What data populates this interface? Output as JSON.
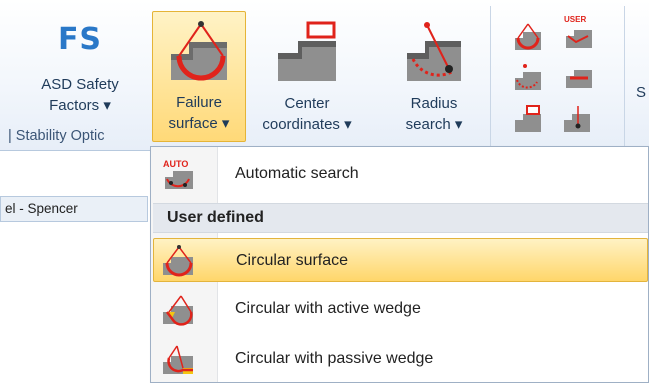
{
  "ribbon": {
    "fs_logo_text": "FS",
    "buttons": {
      "safety": {
        "line1": "ASD Safety",
        "line2": "Factors ▾"
      },
      "failure": {
        "line1": "Failure",
        "line2": "surface ▾"
      },
      "center": {
        "line1": "Center",
        "line2": "coordinates ▾"
      },
      "radius": {
        "line1": "Radius",
        "line2": "search ▾"
      }
    },
    "group_label": "| Stability Optic",
    "cut_label": "S",
    "user_badge": "USER"
  },
  "tab": {
    "label": "el - Spencer"
  },
  "dropdown": {
    "auto_badge": "AUTO",
    "items": [
      {
        "label": "Automatic search",
        "icon": "auto-search-icon"
      },
      {
        "label": "Circular surface",
        "icon": "circular-surface-icon"
      },
      {
        "label": "Circular with active wedge",
        "icon": "active-wedge-icon"
      },
      {
        "label": "Circular with passive wedge",
        "icon": "passive-wedge-icon"
      }
    ],
    "header": "User defined"
  },
  "colors": {
    "accent": "#2a78c8",
    "highlight": "#ffd66a",
    "red": "#e0231b"
  }
}
